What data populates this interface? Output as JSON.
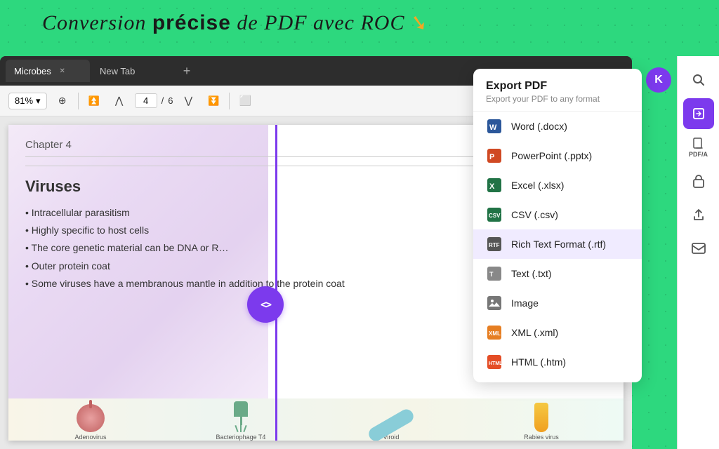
{
  "banner": {
    "text": "Conversion précise de PDF avec ROC",
    "arrow": "➘"
  },
  "browser": {
    "tabs": [
      {
        "id": "microbes",
        "label": "Microbes",
        "active": true
      },
      {
        "id": "new-tab",
        "label": "New Tab",
        "active": false
      }
    ],
    "toolbar": {
      "zoom": "81%",
      "page_current": "4",
      "page_total": "6",
      "zoom_chevron": "▾"
    }
  },
  "pdf": {
    "chapter": "Chapter 4",
    "title": "Viruses",
    "bullets": [
      "Intracellular parasitism",
      "Highly specific to host cells",
      "The core genetic material can be DNA or R…",
      "Outer protein coat",
      "Some viruses have a membranous mantle in addition to the protein coat"
    ]
  },
  "export_panel": {
    "title": "Export PDF",
    "subtitle": "Export your PDF to any format",
    "items": [
      {
        "id": "word",
        "label": "Word (.docx)",
        "icon": "📄"
      },
      {
        "id": "powerpoint",
        "label": "PowerPoint (.pptx)",
        "icon": "📊"
      },
      {
        "id": "excel",
        "label": "Excel (.xlsx)",
        "icon": "📗"
      },
      {
        "id": "csv",
        "label": "CSV (.csv)",
        "icon": "📋"
      },
      {
        "id": "rtf",
        "label": "Rich Text Format (.rtf)",
        "icon": "📝",
        "selected": true
      },
      {
        "id": "text",
        "label": "Text (.txt)",
        "icon": "📃"
      },
      {
        "id": "image",
        "label": "Image",
        "icon": "🖼️"
      },
      {
        "id": "xml",
        "label": "XML (.xml)",
        "icon": "🗂️"
      },
      {
        "id": "html",
        "label": "HTML (.htm)",
        "icon": "🌐"
      }
    ]
  },
  "sidebar": {
    "icons": [
      {
        "id": "search",
        "symbol": "🔍",
        "active": false
      },
      {
        "id": "convert",
        "symbol": "🔄",
        "active": true
      },
      {
        "id": "pdfa",
        "label": "PDF/A",
        "active": false
      },
      {
        "id": "lock",
        "symbol": "🔒",
        "active": false
      },
      {
        "id": "share",
        "symbol": "↑",
        "active": false
      },
      {
        "id": "mail",
        "symbol": "✉",
        "active": false
      }
    ]
  },
  "user": {
    "initial": "K"
  },
  "micro_labels": [
    "Adenovirus",
    "Bacteriophage T4",
    "Viroid",
    "Rabies virus"
  ]
}
